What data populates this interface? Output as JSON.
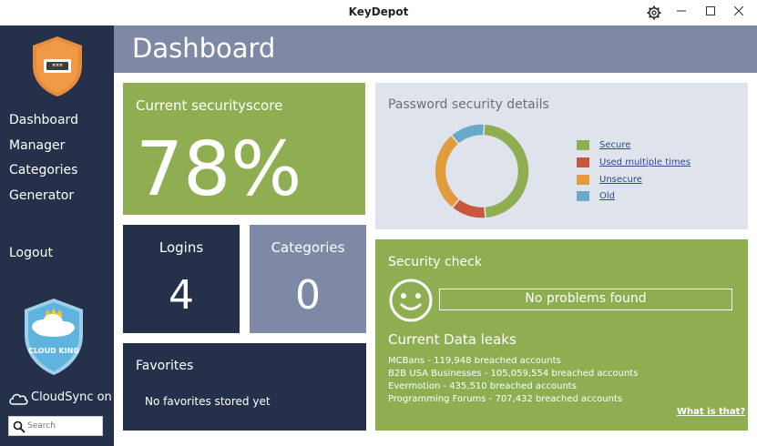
{
  "window": {
    "title": "KeyDepot"
  },
  "sidebar": {
    "items": [
      {
        "label": "Dashboard"
      },
      {
        "label": "Manager"
      },
      {
        "label": "Categories"
      },
      {
        "label": "Generator"
      }
    ],
    "logout": "Logout",
    "cloud_badge": "CLOUD KING",
    "cloudsync": "CloudSync on",
    "search_placeholder": "Search"
  },
  "header": {
    "title": "Dashboard"
  },
  "score": {
    "label": "Current securityscore",
    "value": "78%"
  },
  "logins": {
    "label": "Logins",
    "value": "4"
  },
  "categories": {
    "label": "Categories",
    "value": "0"
  },
  "favorites": {
    "label": "Favorites",
    "empty": "No favorites stored yet"
  },
  "details": {
    "title": "Password security details",
    "segments": [
      {
        "label": "Secure",
        "color": "#8fae52",
        "fraction": 0.48
      },
      {
        "label": "Used multiple times",
        "color": "#c9573d",
        "fraction": 0.12
      },
      {
        "label": "Unsecure",
        "color": "#e29c3e",
        "fraction": 0.28
      },
      {
        "label": "Old",
        "color": "#6aaac8",
        "fraction": 0.12
      }
    ]
  },
  "security_check": {
    "title": "Security check",
    "status": "No problems found",
    "leaks_title": "Current Data leaks",
    "leaks": [
      "MCBans - 119,948 breached accounts",
      "B2B USA Businesses - 105,059,554 breached accounts",
      "Evermotion - 435,510 breached accounts",
      "Programming Forums - 707,432 breached accounts"
    ],
    "help_link": "What is that?"
  }
}
